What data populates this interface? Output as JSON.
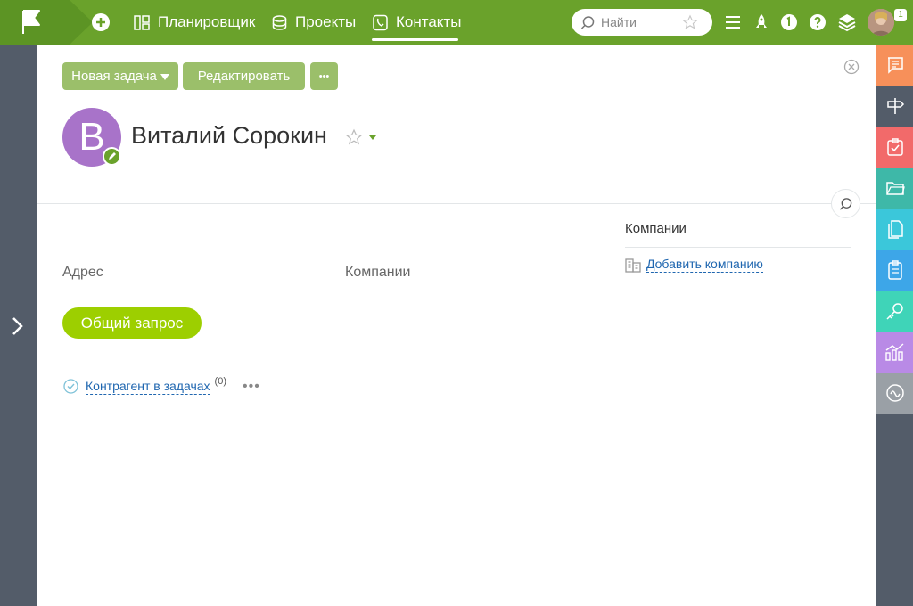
{
  "topbar": {
    "nav": [
      {
        "label": "Планировщик",
        "icon": "planner-icon"
      },
      {
        "label": "Проекты",
        "icon": "projects-icon"
      },
      {
        "label": "Контакты",
        "icon": "contacts-icon",
        "active": true
      }
    ],
    "search_placeholder": "Найти",
    "notification_count": "1"
  },
  "toolbar": {
    "new_task_label": "Новая задача",
    "edit_label": "Редактировать",
    "more_label": "•••"
  },
  "contact": {
    "initial": "В",
    "name": "Виталий Сорокин"
  },
  "fields": {
    "address_label": "Адрес",
    "companies_label": "Компании",
    "general_request_label": "Общий запрос",
    "counterparty_link": "Контрагент в задачах",
    "counterparty_count": "(0)",
    "more_dots": "•••"
  },
  "side": {
    "companies_title": "Компании",
    "add_company_label": "Добавить компанию"
  },
  "right_rail": [
    {
      "icon": "chat-icon",
      "color": "#f7905a"
    },
    {
      "icon": "signpost-icon",
      "color": "#535c69"
    },
    {
      "icon": "tasks-icon",
      "color": "#f26a6a"
    },
    {
      "icon": "folder-icon",
      "color": "#3eb8a8"
    },
    {
      "icon": "documents-icon",
      "color": "#3bc7da"
    },
    {
      "icon": "clipboard-icon",
      "color": "#3da6e8"
    },
    {
      "icon": "key-icon",
      "color": "#3fd4b8"
    },
    {
      "icon": "chart-icon",
      "color": "#b98ae6"
    },
    {
      "icon": "wave-icon",
      "color": "#9aa0a6"
    }
  ],
  "colors": {
    "brand": "#6aa22b",
    "rail": "#535c69",
    "pill": "#9dcf00",
    "avatar": "#a873c9",
    "link": "#2067b0"
  }
}
